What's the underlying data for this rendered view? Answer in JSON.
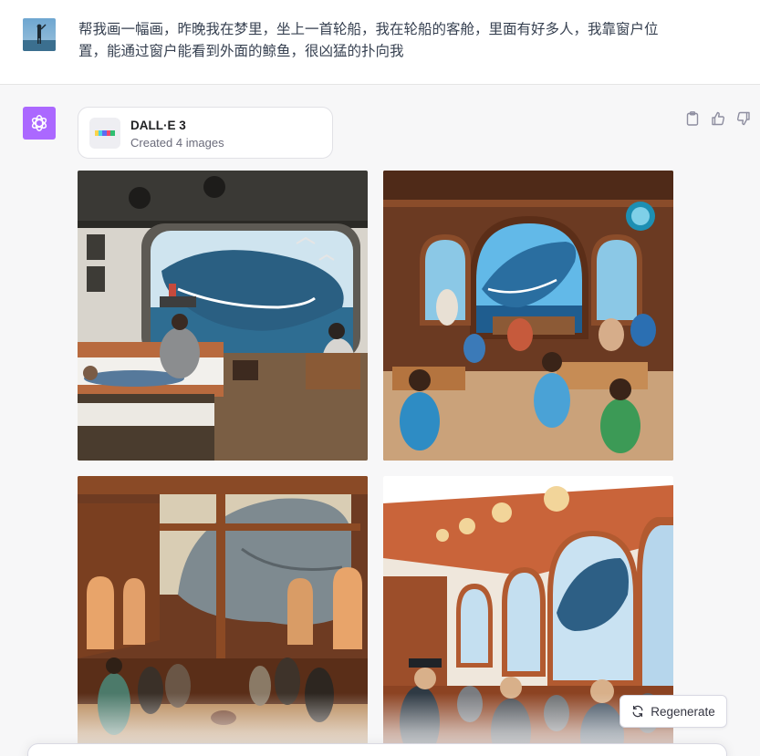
{
  "user_message": {
    "avatar": "user-photo-avatar",
    "text": "帮我画一幅画，昨晚我在梦里，坐上一首轮船，我在轮船的客舱，里面有好多人，我靠窗户位置，能通过窗户能看到外面的鲸鱼，很凶猛的扑向我"
  },
  "assistant": {
    "avatar": "openai-logo-icon",
    "tool": {
      "name": "DALL·E 3",
      "status": "Created 4 images",
      "icon": "dalle-color-bar-icon"
    },
    "actions": [
      "clipboard-icon",
      "thumbs-up-icon",
      "thumbs-down-icon"
    ],
    "images": [
      {
        "name": "generated-image-1"
      },
      {
        "name": "generated-image-2"
      },
      {
        "name": "generated-image-3"
      },
      {
        "name": "generated-image-4"
      }
    ]
  },
  "regenerate": {
    "label": "Regenerate",
    "icon": "refresh-icon"
  },
  "colors": {
    "accent_purple": "#ab68ff",
    "background": "#f7f7f8"
  }
}
